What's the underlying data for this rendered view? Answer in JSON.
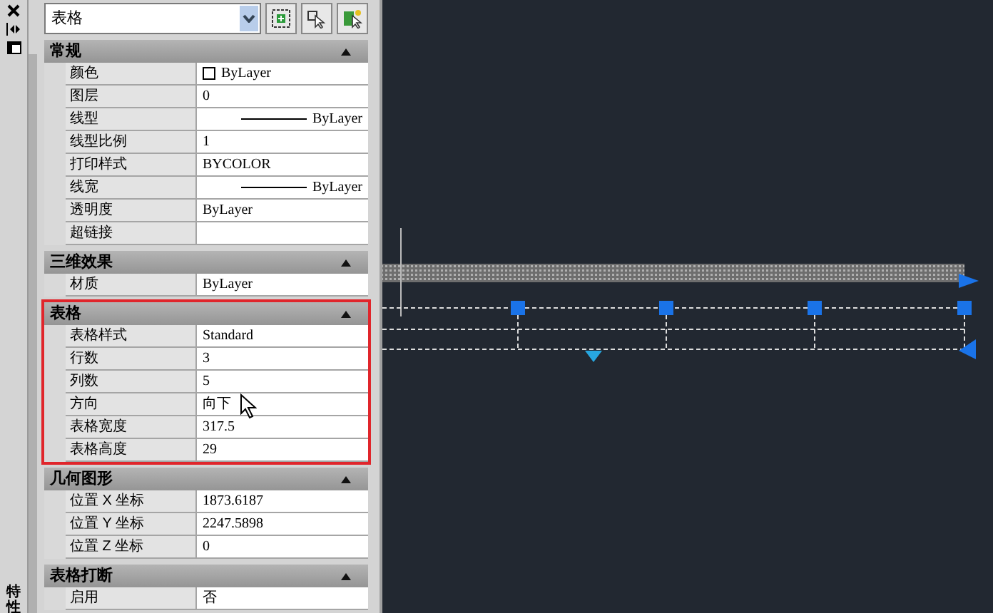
{
  "side_strip": {
    "title": "特性"
  },
  "selector": {
    "value": "表格"
  },
  "sections": [
    {
      "title": "常规",
      "expanded": true,
      "highlighted": false,
      "rows": [
        {
          "label": "颜色",
          "value": "ByLayer",
          "kind": "color"
        },
        {
          "label": "图层",
          "value": "0",
          "kind": "text"
        },
        {
          "label": "线型",
          "value": "ByLayer",
          "kind": "line"
        },
        {
          "label": "线型比例",
          "value": "1",
          "kind": "text"
        },
        {
          "label": "打印样式",
          "value": "BYCOLOR",
          "kind": "text"
        },
        {
          "label": "线宽",
          "value": "ByLayer",
          "kind": "line"
        },
        {
          "label": "透明度",
          "value": "ByLayer",
          "kind": "text"
        },
        {
          "label": "超链接",
          "value": "",
          "kind": "text"
        }
      ]
    },
    {
      "title": "三维效果",
      "expanded": true,
      "highlighted": false,
      "rows": [
        {
          "label": "材质",
          "value": "ByLayer",
          "kind": "text"
        }
      ]
    },
    {
      "title": "表格",
      "expanded": true,
      "highlighted": true,
      "rows": [
        {
          "label": "表格样式",
          "value": "Standard",
          "kind": "text"
        },
        {
          "label": "行数",
          "value": "3",
          "kind": "text"
        },
        {
          "label": "列数",
          "value": "5",
          "kind": "text"
        },
        {
          "label": "方向",
          "value": "向下",
          "kind": "text"
        },
        {
          "label": "表格宽度",
          "value": "317.5",
          "kind": "text"
        },
        {
          "label": "表格高度",
          "value": "29",
          "kind": "text"
        }
      ]
    },
    {
      "title": "几何图形",
      "expanded": true,
      "highlighted": false,
      "rows": [
        {
          "label": "位置 X 坐标",
          "value": "1873.6187",
          "kind": "text"
        },
        {
          "label": "位置 Y 坐标",
          "value": "2247.5898",
          "kind": "text"
        },
        {
          "label": "位置 Z 坐标",
          "value": "0",
          "kind": "text"
        }
      ]
    },
    {
      "title": "表格打断",
      "expanded": true,
      "highlighted": false,
      "rows": [
        {
          "label": "启用",
          "value": "否",
          "kind": "text"
        }
      ]
    }
  ]
}
